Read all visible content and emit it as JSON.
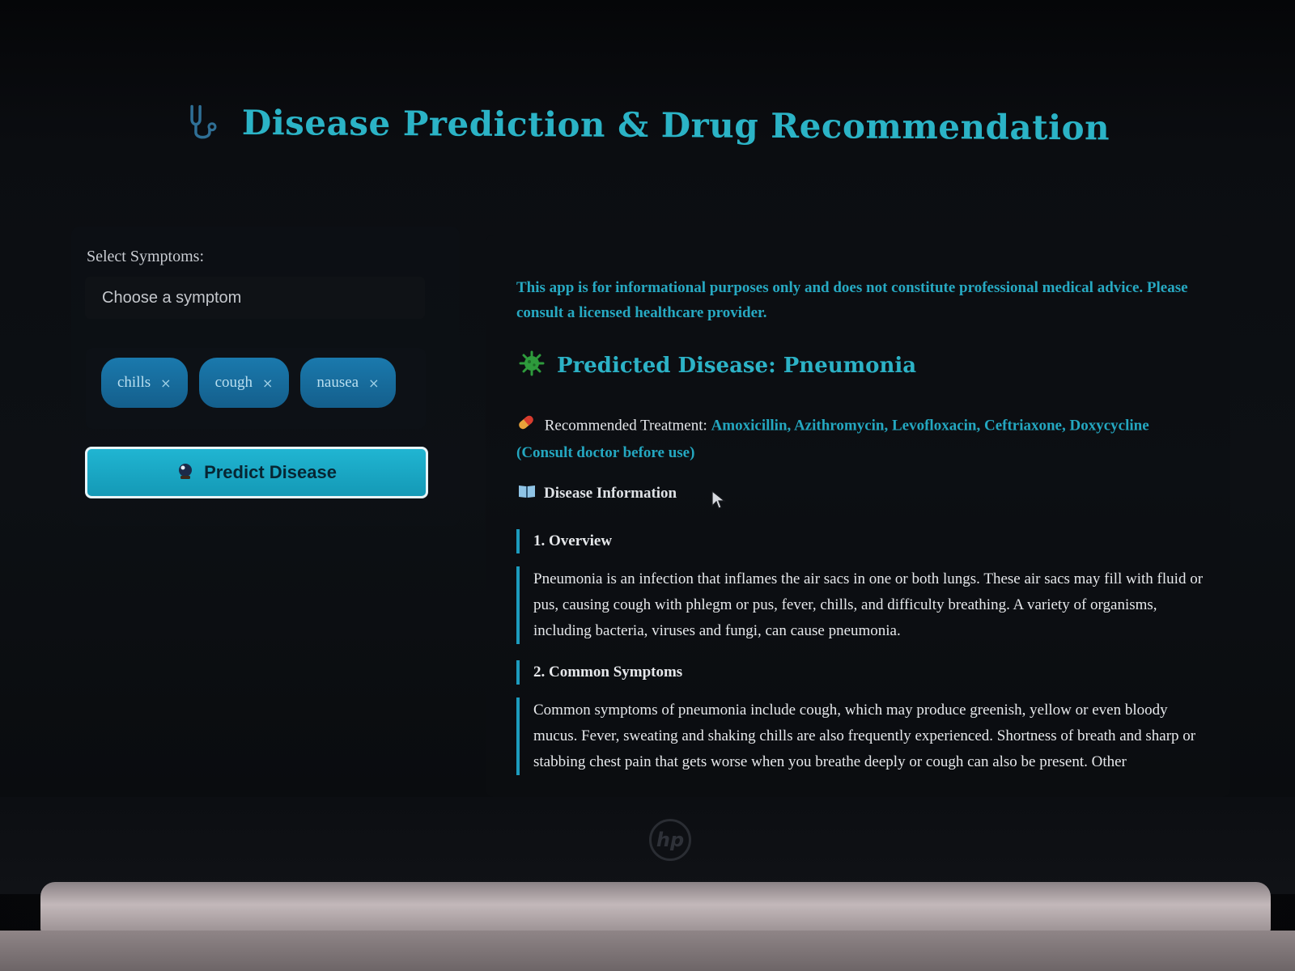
{
  "header": {
    "title": "Disease Prediction & Drug Recommendation",
    "icon": "stethoscope-icon"
  },
  "symptoms": {
    "label": "Select Symptoms:",
    "placeholder": "Choose a symptom",
    "selected": [
      "chills",
      "cough",
      "nausea"
    ],
    "remove_symbol": "×"
  },
  "predict_button": {
    "label": "Predict Disease",
    "icon": "crystal-ball-icon"
  },
  "result": {
    "disclaimer": "This app is for informational purposes only and does not constitute professional medical advice. Please consult a licensed healthcare provider.",
    "predicted_label": "Predicted Disease: Pneumonia",
    "predicted_icon": "microbe-icon",
    "treatment_label": "Recommended Treatment:",
    "treatment_icon": "pill-icon",
    "drugs": "Amoxicillin, Azithromycin, Levofloxacin, Ceftriaxone, Doxycycline",
    "consult_note": "(Consult doctor before use)",
    "info_heading": "Disease Information",
    "info_icon": "book-icon",
    "sections": [
      {
        "heading": "1. Overview",
        "body": "Pneumonia is an infection that inflames the air sacs in one or both lungs. These air sacs may fill with fluid or pus, causing cough with phlegm or pus, fever, chills, and difficulty breathing. A variety of organisms, including bacteria, viruses and fungi, can cause pneumonia."
      },
      {
        "heading": "2. Common Symptoms",
        "body": "Common symptoms of pneumonia include cough, which may produce greenish, yellow or even bloody mucus. Fever, sweating and shaking chills are also frequently experienced. Shortness of breath and sharp or stabbing chest pain that gets worse when you breathe deeply or cough can also be present. Other"
      }
    ]
  },
  "device": {
    "logo_text": "hp"
  },
  "colors": {
    "accent": "#2bb3c6",
    "chip": "#1a79ad",
    "button": "#20b5d2",
    "background": "#0d1014"
  }
}
